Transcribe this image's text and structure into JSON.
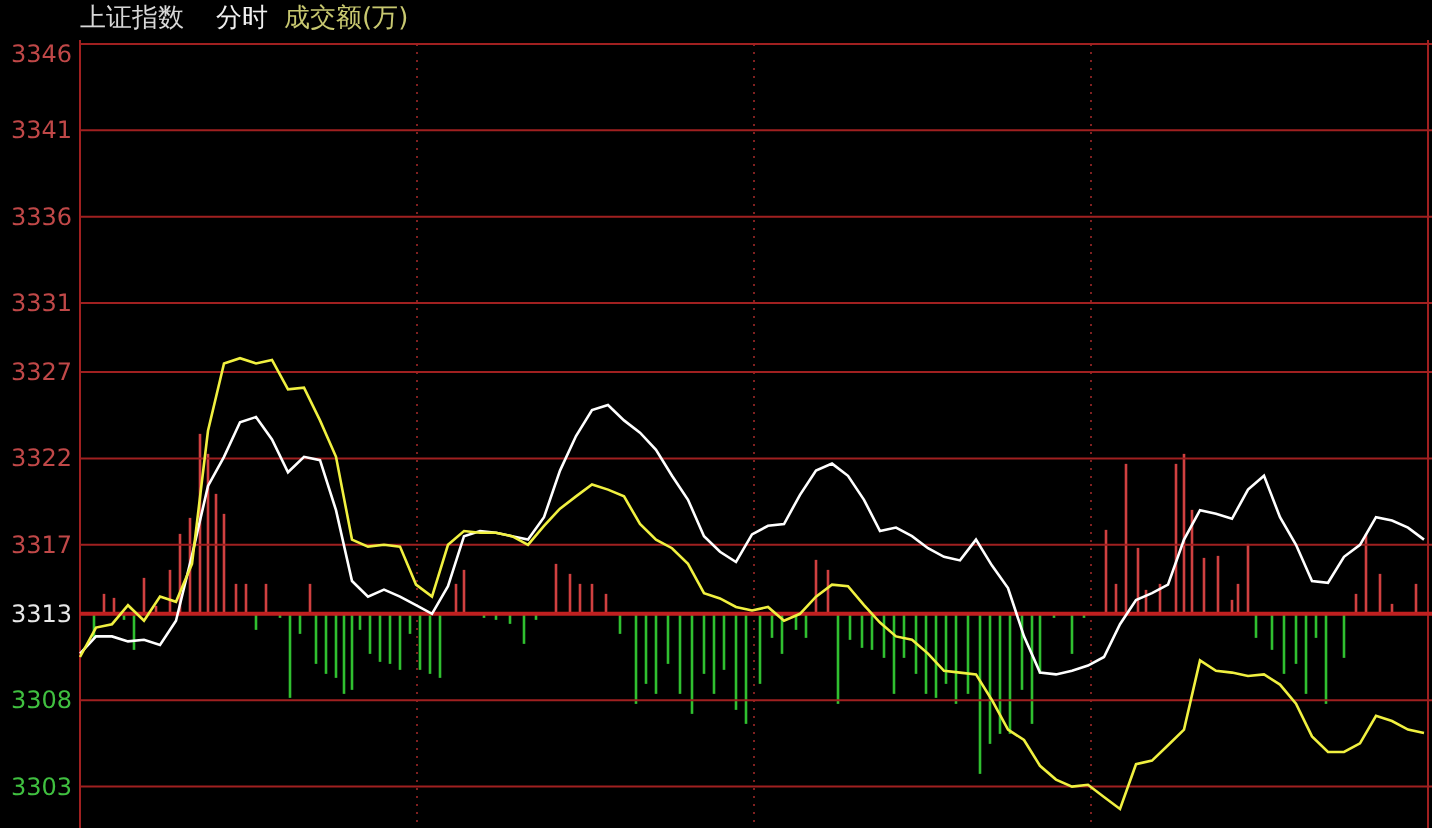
{
  "header": {
    "index_name": "上证指数",
    "mode": "分时",
    "indicator": "成交额(万)"
  },
  "chart": {
    "chart_data": {
      "type": "line",
      "ylim": [
        3300.6,
        3346
      ],
      "yticks": [
        3346,
        3341,
        3336,
        3331,
        3327,
        3322,
        3317,
        3313,
        3308,
        3303
      ],
      "grid": true,
      "ref_lines": [
        {
          "axis": "y",
          "value": 3313
        }
      ],
      "series": [
        {
          "color": "#ffffff",
          "values": [
            3310.7,
            3311.7,
            3311.7,
            3311.4,
            3311.5,
            3311.2,
            3312.6,
            3316.4,
            3320.4,
            3322.1,
            3324.1,
            3324.4,
            3323.1,
            3321.2,
            3322.1,
            3321.9,
            3319.0,
            3314.9,
            3314.0,
            3314.4,
            3314.0,
            3313.5,
            3313.0,
            3314.6,
            3317.5,
            3317.8,
            3317.7,
            3317.5,
            3317.3,
            3318.6,
            3321.3,
            3323.3,
            3324.8,
            3325.1,
            3324.2,
            3323.5,
            3322.5,
            3321.0,
            3319.6,
            3317.5,
            3316.6,
            3316.0,
            3317.6,
            3318.1,
            3318.2,
            3319.9,
            3321.3,
            3321.7,
            3321.0,
            3319.6,
            3317.8,
            3318.0,
            3317.5,
            3316.8,
            3316.3,
            3316.1,
            3317.3,
            3315.8,
            3314.5,
            3311.7,
            3309.6,
            3309.5,
            3309.7,
            3310.0,
            3310.5,
            3312.4,
            3313.8,
            3314.2,
            3314.7,
            3317.3,
            3319.0,
            3318.8,
            3318.5,
            3320.2,
            3321.0,
            3318.6,
            3317.0,
            3314.9,
            3314.8,
            3316.3,
            3317.0,
            3318.6,
            3318.4,
            3318.0,
            3317.3
          ]
        },
        {
          "color": "#f0f040",
          "values": [
            3310.5,
            3312.2,
            3312.4,
            3313.5,
            3312.6,
            3314.0,
            3313.7,
            3315.9,
            3323.6,
            3327.5,
            3327.8,
            3327.5,
            3327.7,
            3326.0,
            3326.1,
            3324.2,
            3322.1,
            3317.3,
            3316.9,
            3317.0,
            3316.9,
            3314.7,
            3314.0,
            3317.0,
            3317.8,
            3317.7,
            3317.7,
            3317.5,
            3317.0,
            3318.1,
            3319.1,
            3319.8,
            3320.5,
            3320.2,
            3319.8,
            3318.2,
            3317.3,
            3316.8,
            3315.9,
            3314.2,
            3313.9,
            3313.4,
            3313.2,
            3313.4,
            3312.6,
            3313.0,
            3314.0,
            3314.7,
            3314.6,
            3313.5,
            3312.5,
            3311.7,
            3311.5,
            3310.7,
            3309.7,
            3309.6,
            3309.5,
            3308.0,
            3306.3,
            3305.7,
            3304.2,
            3303.4,
            3303.0,
            3303.1,
            3302.4,
            3301.7,
            3304.3,
            3304.5,
            3305.4,
            3306.3,
            3310.3,
            3309.7,
            3309.6,
            3309.4,
            3309.5,
            3308.9,
            3307.8,
            3305.9,
            3305.0,
            3305.0,
            3305.5,
            3307.1,
            3306.8,
            3306.3,
            3306.1
          ]
        }
      ]
    }
  }
}
